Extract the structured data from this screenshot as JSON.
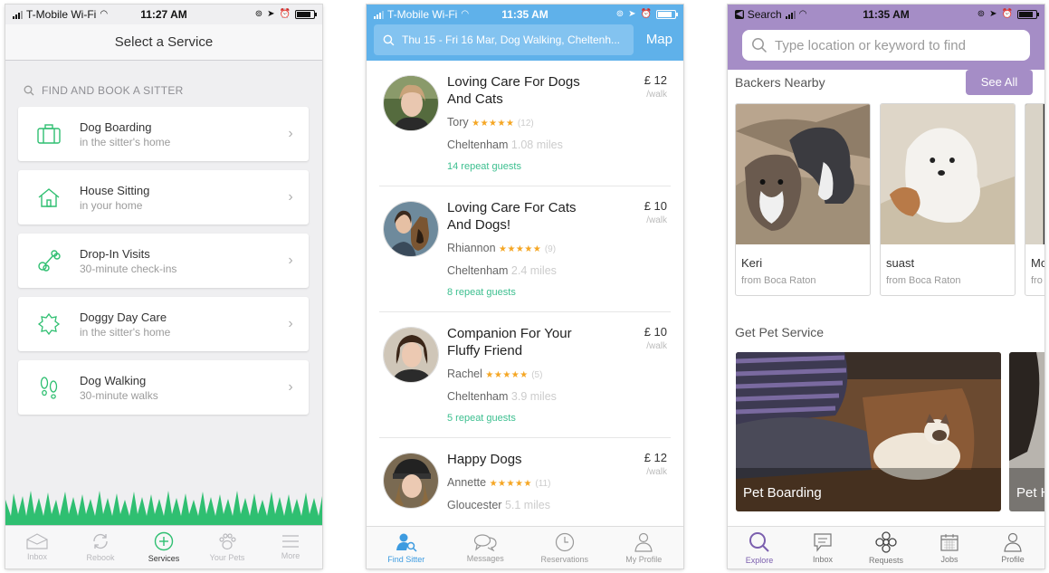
{
  "phone1": {
    "status": {
      "carrier": "T-Mobile Wi-Fi",
      "time": "11:27 AM"
    },
    "header_title": "Select a Service",
    "section_label": "FIND AND BOOK A SITTER",
    "services": [
      {
        "title": "Dog Boarding",
        "subtitle": "in the sitter's home",
        "icon": "suitcase-icon"
      },
      {
        "title": "House Sitting",
        "subtitle": "in your home",
        "icon": "house-icon"
      },
      {
        "title": "Drop-In Visits",
        "subtitle": "30-minute check-ins",
        "icon": "bone-icon"
      },
      {
        "title": "Doggy Day Care",
        "subtitle": "in the sitter's home",
        "icon": "sun-badge-icon"
      },
      {
        "title": "Dog Walking",
        "subtitle": "30-minute walks",
        "icon": "paw-prints-icon"
      }
    ],
    "tabs": [
      "Inbox",
      "Rebook",
      "Services",
      "Your Pets",
      "More"
    ],
    "active_tab": "Services",
    "accent_color": "#2fbf71"
  },
  "phone2": {
    "status": {
      "carrier": "T-Mobile Wi-Fi",
      "time": "11:35 AM"
    },
    "search_text": "Thu 15 - Fri 16 Mar, Dog Walking, Cheltenh...",
    "map_label": "Map",
    "sitters": [
      {
        "title": "Loving Care For Dogs And Cats",
        "sitter": "Tory",
        "stars": "★★★★★",
        "reviews": "(12)",
        "town": "Cheltenham",
        "distance": "1.08 miles",
        "repeat": "14 repeat guests",
        "price": "£ 12",
        "unit": "/walk"
      },
      {
        "title": "Loving Care For Cats And Dogs!",
        "sitter": "Rhiannon",
        "stars": "★★★★★",
        "reviews": "(9)",
        "town": "Cheltenham",
        "distance": "2.4 miles",
        "repeat": "8 repeat guests",
        "price": "£ 10",
        "unit": "/walk"
      },
      {
        "title": "Companion For Your Fluffy Friend",
        "sitter": "Rachel",
        "stars": "★★★★★",
        "reviews": "(5)",
        "town": "Cheltenham",
        "distance": "3.9 miles",
        "repeat": "5 repeat guests",
        "price": "£ 10",
        "unit": "/walk"
      },
      {
        "title": "Happy Dogs",
        "sitter": "Annette",
        "stars": "★★★★★",
        "reviews": "(11)",
        "town": "Gloucester",
        "distance": "5.1 miles",
        "repeat": "",
        "price": "£ 12",
        "unit": "/walk"
      }
    ],
    "tabs": [
      "Find Sitter",
      "Messages",
      "Reservations",
      "My Profile"
    ],
    "active_tab": "Find Sitter",
    "accent_color": "#5fb1ea"
  },
  "phone3": {
    "status": {
      "back_label": "Search",
      "time": "11:35 AM"
    },
    "search_placeholder": "Type location or keyword to find",
    "backers_title": "Backers Nearby",
    "see_all": "See All",
    "backers": [
      {
        "name": "Keri",
        "from": "from Boca Raton"
      },
      {
        "name": "suast",
        "from": "from Boca Raton"
      },
      {
        "name": "Mo",
        "from": "fro"
      }
    ],
    "services_title": "Get Pet Service",
    "service_cards": [
      "Pet Boarding",
      "Pet H"
    ],
    "tabs": [
      "Explore",
      "Inbox",
      "Requests",
      "Jobs",
      "Profile"
    ],
    "active_tab": "Explore",
    "accent_color": "#a58dc6"
  }
}
